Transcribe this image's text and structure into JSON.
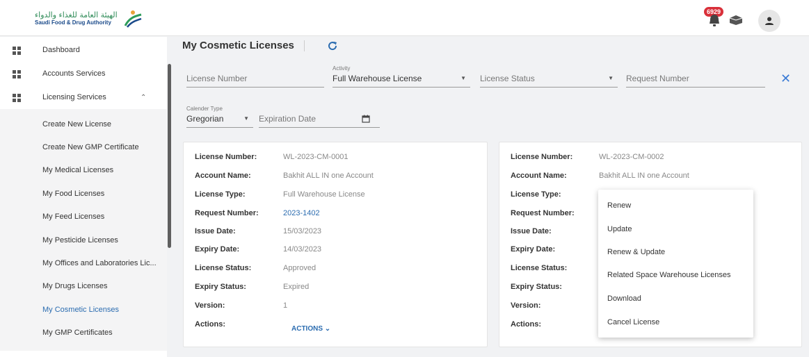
{
  "header": {
    "logo_ar": "الهيئة العامة للغذاء والدواء",
    "logo_en": "Saudi Food & Drug Authority",
    "notification_count": "6929"
  },
  "sidebar": {
    "items": [
      {
        "label": "Dashboard"
      },
      {
        "label": "Accounts Services"
      },
      {
        "label": "Licensing Services"
      }
    ],
    "sub_items": [
      {
        "label": "Create New License"
      },
      {
        "label": "Create New GMP Certificate"
      },
      {
        "label": "My Medical Licenses"
      },
      {
        "label": "My Food Licenses"
      },
      {
        "label": "My Feed Licenses"
      },
      {
        "label": "My Pesticide Licenses"
      },
      {
        "label": "My Offices and Laboratories Lic..."
      },
      {
        "label": "My Drugs Licenses"
      },
      {
        "label": "My Cosmetic Licenses"
      },
      {
        "label": "My GMP Certificates"
      }
    ]
  },
  "page": {
    "title": "My Cosmetic Licenses"
  },
  "filters": {
    "license_number_placeholder": "License Number",
    "activity_label": "Activity",
    "activity_value": "Full Warehouse License",
    "license_status_placeholder": "License Status",
    "request_number_placeholder": "Request Number",
    "calendar_type_label": "Calender Type",
    "calendar_type_value": "Gregorian",
    "expiration_date_placeholder": "Expiration Date"
  },
  "labels": {
    "license_number": "License Number:",
    "account_name": "Account Name:",
    "license_type": "License Type:",
    "request_number": "Request Number:",
    "issue_date": "Issue Date:",
    "expiry_date": "Expiry Date:",
    "license_status": "License Status:",
    "expiry_status": "Expiry Status:",
    "version": "Version:",
    "actions": "Actions:"
  },
  "cards": [
    {
      "license_number": "WL-2023-CM-0001",
      "account_name": "Bakhit ALL IN one Account",
      "license_type": "Full Warehouse License",
      "request_number": "2023-1402",
      "issue_date": "15/03/2023",
      "expiry_date": "14/03/2023",
      "license_status": "Approved",
      "expiry_status": "Expired",
      "version": "1",
      "actions_label": "ACTIONS ⌄"
    },
    {
      "license_number": "WL-2023-CM-0002",
      "account_name": "Bakhit ALL IN one Account"
    }
  ],
  "actions_menu": [
    {
      "label": "Renew"
    },
    {
      "label": "Update"
    },
    {
      "label": "Renew & Update"
    },
    {
      "label": "Related Space Warehouse Licenses"
    },
    {
      "label": "Download"
    },
    {
      "label": "Cancel License"
    }
  ],
  "colors": {
    "accent": "#2b6cb0",
    "badge": "#d9303a"
  }
}
